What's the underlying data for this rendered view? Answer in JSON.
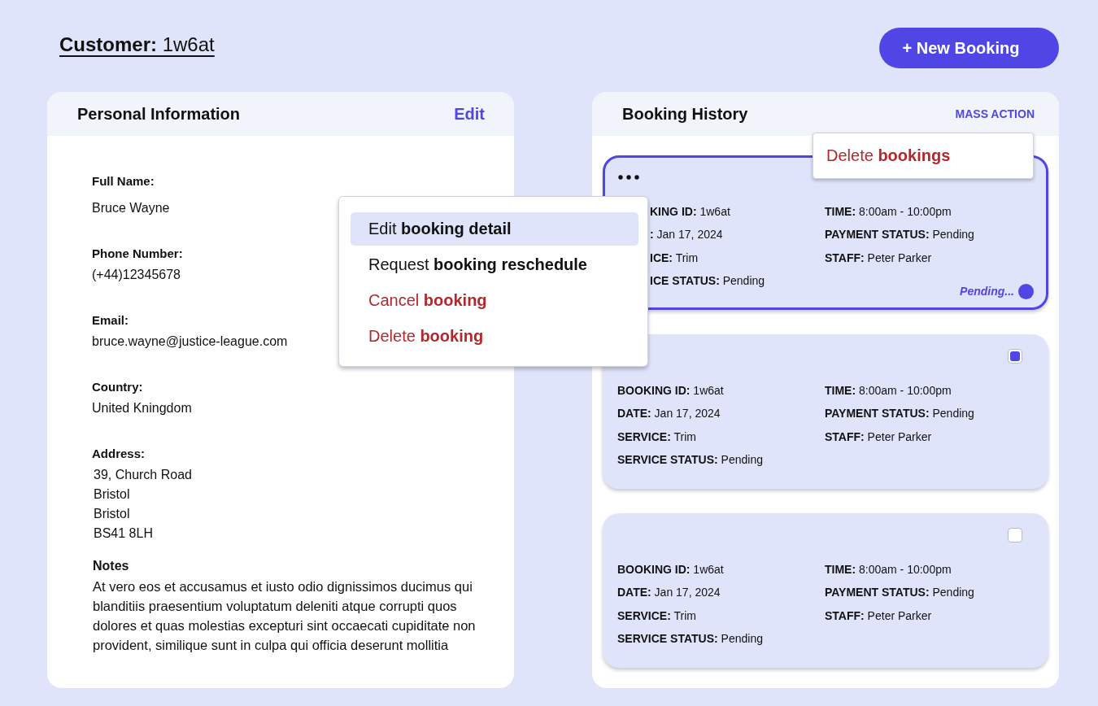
{
  "header": {
    "title": "**Customer:** 1w6at",
    "new_booking_button": "+ New Booking"
  },
  "personal_information": {
    "title": "Personal Information",
    "edit_link": "Edit",
    "fields": [
      {
        "label": "Full Name:",
        "value": "Bruce Wayne"
      },
      {
        "label": "Phone Number:",
        "value": "(+44)12345678"
      },
      {
        "label": "Email:",
        "value": "bruce.wayne@justice-league.com"
      },
      {
        "label": "Country:",
        "value": "United Kningdom"
      },
      {
        "label": "Address:",
        "lines": [
          "39, Church Road",
          "Bristol",
          "Bristol",
          "BS41 8LH"
        ]
      }
    ],
    "notes": {
      "label": "Notes",
      "text": "At vero eos et accusamus et iusto odio dignissimos ducimus qui blanditiis praesentium voluptatum deleniti atque corrupti quos dolores et quas molestias excepturi sint occaecati cupiditate non provident, similique sunt in culpa qui officia deserunt mollitia"
    }
  },
  "booking_history": {
    "title": "Booking History",
    "mass_action": "MASS ACTION",
    "mass_action_menu": {
      "items": [
        {
          "text": "Delete **bookings**",
          "kind": "danger"
        }
      ]
    },
    "bookings": [
      {
        "selected": true,
        "left": [
          "**KING ID:** 1w6at",
          "**:** Jan 17, 2024",
          "**ICE:** Trim",
          "**ICE STATUS:** Pending"
        ],
        "right": [
          "**TIME:** 8:00am - 10:00pm",
          "**PAYMENT STATUS:** Pending",
          "**STAFF:** Peter Parker"
        ],
        "status": "Pending...",
        "menu": {
          "items": [
            {
              "text": "Edit **booking detail**",
              "kind": "normal",
              "selected": true
            },
            {
              "text": "Request **booking reschedule**",
              "kind": "normal",
              "selected": false
            },
            {
              "text": "Cancel **booking**",
              "kind": "danger",
              "selected": false
            },
            {
              "text": "Delete **booking**",
              "kind": "danger",
              "selected": false
            }
          ]
        }
      },
      {
        "selected": false,
        "checked": true,
        "left": [
          "**BOOKING ID:** 1w6at",
          "**DATE:** Jan 17, 2024",
          "**SERVICE:** Trim",
          "**SERVICE STATUS:** Pending"
        ],
        "right": [
          "**TIME:** 8:00am - 10:00pm",
          "**PAYMENT STATUS:** Pending",
          "**STAFF:** Peter Parker"
        ]
      },
      {
        "selected": false,
        "checked": false,
        "left": [
          "**BOOKING ID:** 1w6at",
          "**DATE:** Jan 17, 2024",
          "**SERVICE:** Trim",
          "**SERVICE STATUS:** Pending"
        ],
        "right": [
          "**TIME:** 8:00am - 10:00pm",
          "**PAYMENT STATUS:** Pending",
          "**STAFF:** Peter Parker"
        ]
      }
    ]
  }
}
